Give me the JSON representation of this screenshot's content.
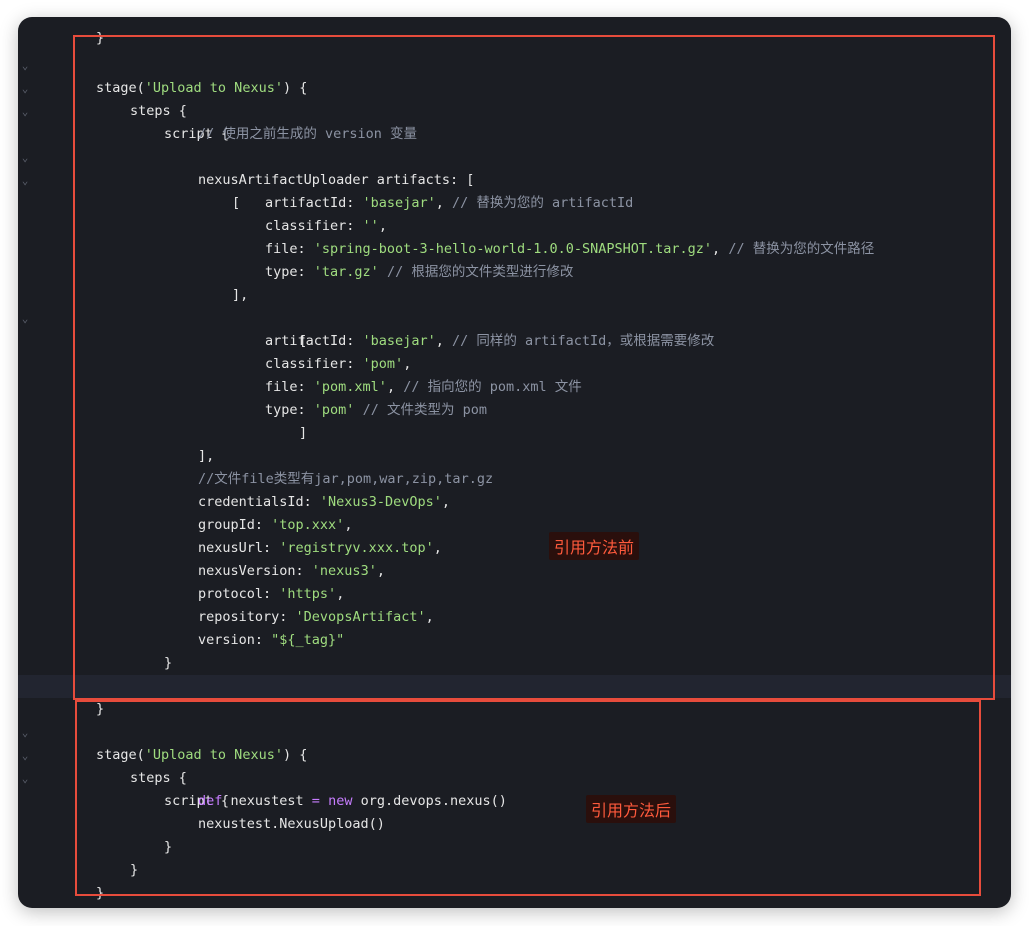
{
  "colors": {
    "background": "#1b1d23",
    "text": "#e6e6e6",
    "string": "#9fdc7f",
    "comment": "#8c93a3",
    "keyword": "#c77dff",
    "annotation": "#e74c3c"
  },
  "code": {
    "l0": "}",
    "l1a": "stage(",
    "l1b": "'Upload to Nexus'",
    "l1c": ") {",
    "l2": "steps {",
    "l3": "script {",
    "l4": "// 使用之前生成的 version 变量",
    "l5": "nexusArtifactUploader artifacts: [",
    "l6": "[",
    "l7a": "artifactId: ",
    "l7b": "'basejar'",
    "l7c": ", ",
    "l7d": "// 替换为您的 artifactId",
    "l8a": "classifier: ",
    "l8b": "''",
    "l8c": ",",
    "l9a": "file: ",
    "l9b": "'spring-boot-3-hello-world-1.0.0-SNAPSHOT.tar.gz'",
    "l9c": ", ",
    "l9d": "// 替换为您的文件路径",
    "l10a": "type: ",
    "l10b": "'tar.gz'",
    "l10c": " ",
    "l10d": "// 根据您的文件类型进行修改",
    "l11": "],",
    "l12": "[",
    "l13a": "artifactId: ",
    "l13b": "'basejar'",
    "l13c": ", ",
    "l13d": "// 同样的 artifactId，或根据需要修改",
    "l14a": "classifier: ",
    "l14b": "'pom'",
    "l14c": ",",
    "l15a": "file: ",
    "l15b": "'pom.xml'",
    "l15c": ", ",
    "l15d": "// 指向您的 pom.xml 文件",
    "l16a": "type: ",
    "l16b": "'pom'",
    "l16c": " ",
    "l16d": "// 文件类型为 pom",
    "l17": "]",
    "l18": "],",
    "l19": "//文件file类型有jar,pom,war,zip,tar.gz",
    "l20a": "credentialsId: ",
    "l20b": "'Nexus3-DevOps'",
    "l20c": ",",
    "l21a": "groupId: ",
    "l21b": "'top.xxx'",
    "l21c": ",",
    "l22a": "nexusUrl: ",
    "l22b": "'registryv.xxx.top'",
    "l22c": ",",
    "l23a": "nexusVersion: ",
    "l23b": "'nexus3'",
    "l23c": ",",
    "l24a": "protocol: ",
    "l24b": "'https'",
    "l24c": ",",
    "l25a": "repository: ",
    "l25b": "'DevopsArtifact'",
    "l25c": ",",
    "l26a": "version: ",
    "l26b": "\"${_tag}\"",
    "l27": "}",
    "l28": "}",
    "l29": "}",
    "l30a": "stage(",
    "l30b": "'Upload to Nexus'",
    "l30c": ") {",
    "l31": "steps {",
    "l32": "script {",
    "l33a": "def",
    "l33b": " nexustest ",
    "l33c": "=",
    "l33d": " new",
    "l33e": " org.devops.nexus()",
    "l34": "nexustest.NexusUpload()",
    "l35": "}",
    "l36": "}",
    "l37": "}",
    "l38": "}"
  },
  "annotations": {
    "before_label": "引用方法前",
    "after_label": "引用方法后"
  },
  "icons": {
    "fold": "chevron-down-icon"
  }
}
